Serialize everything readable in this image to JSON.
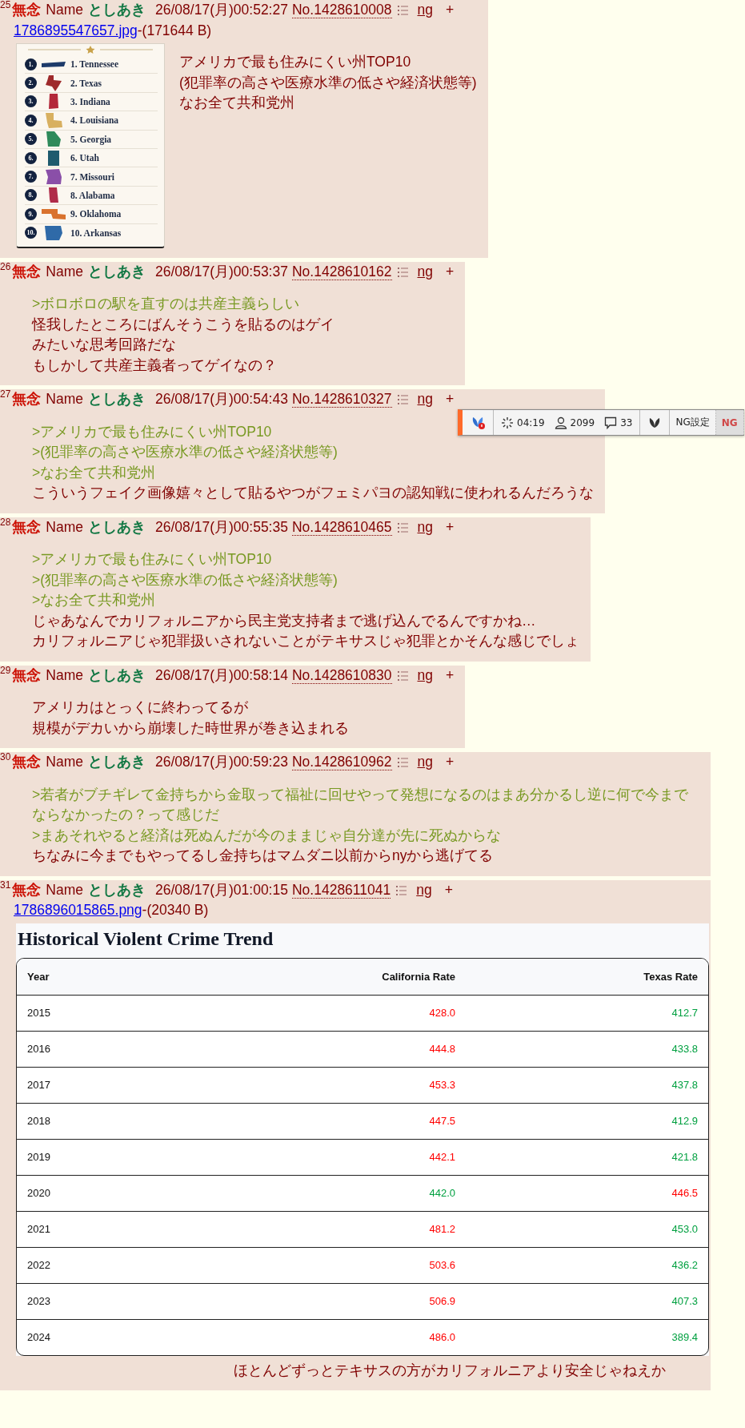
{
  "posts": [
    {
      "number": "25",
      "subject": "無念",
      "name_label": "Name",
      "poster": "としあき",
      "date": "26/08/17(月)00:52:27",
      "no": "No.1428610008",
      "ng": "ng",
      "plus": "+",
      "file": {
        "name": "1786895547657.jpg",
        "size": "-(171644 B)"
      },
      "image": {
        "kind": "ranking",
        "items": [
          {
            "rank": "1.",
            "label": "1. Tennessee",
            "color": "#1d3b6a"
          },
          {
            "rank": "2.",
            "label": "2. Texas",
            "color": "#9e2a2b"
          },
          {
            "rank": "3.",
            "label": "3. Indiana",
            "color": "#b3283a"
          },
          {
            "rank": "4.",
            "label": "4. Louisiana",
            "color": "#d8b060"
          },
          {
            "rank": "5.",
            "label": "5. Georgia",
            "color": "#2e8a5a"
          },
          {
            "rank": "6.",
            "label": "6. Utah",
            "color": "#1e5a6e"
          },
          {
            "rank": "7.",
            "label": "7. Missouri",
            "color": "#8a4fa8"
          },
          {
            "rank": "8.",
            "label": "8. Alabama",
            "color": "#b02c4a"
          },
          {
            "rank": "9.",
            "label": "9. Oklahoma",
            "color": "#d9722e"
          },
          {
            "rank": "10.",
            "label": "10. Arkansas",
            "color": "#2f6aa8"
          }
        ]
      },
      "lines": [
        {
          "kind": "text",
          "text": "アメリカで最も住みにくい州TOP10"
        },
        {
          "kind": "text",
          "text": "(犯罪率の高さや医療水準の低さや経済状態等)"
        },
        {
          "kind": "text",
          "text": "なお全て共和党州"
        }
      ]
    },
    {
      "number": "26",
      "subject": "無念",
      "name_label": "Name",
      "poster": "としあき",
      "date": "26/08/17(月)00:53:37",
      "no": "No.1428610162",
      "ng": "ng",
      "plus": "+",
      "lines": [
        {
          "kind": "quote",
          "text": ">ボロボロの駅を直すのは共産主義らしい"
        },
        {
          "kind": "text",
          "text": "怪我したところにばんそうこうを貼るのはゲイ"
        },
        {
          "kind": "text",
          "text": "みたいな思考回路だな"
        },
        {
          "kind": "text",
          "text": "もしかして共産主義者ってゲイなの？"
        }
      ]
    },
    {
      "number": "27",
      "subject": "無念",
      "name_label": "Name",
      "poster": "としあき",
      "date": "26/08/17(月)00:54:43",
      "no": "No.1428610327",
      "ng": "ng",
      "plus": "+",
      "lines": [
        {
          "kind": "quote",
          "text": ">アメリカで最も住みにくい州TOP10"
        },
        {
          "kind": "quote",
          "text": ">(犯罪率の高さや医療水準の低さや経済状態等)"
        },
        {
          "kind": "quote",
          "text": ">なお全て共和党州"
        },
        {
          "kind": "text",
          "text": "こういうフェイク画像嬉々として貼るやつがフェミパヨの認知戦に使われるんだろうな"
        }
      ]
    },
    {
      "number": "28",
      "subject": "無念",
      "name_label": "Name",
      "poster": "としあき",
      "date": "26/08/17(月)00:55:35",
      "no": "No.1428610465",
      "ng": "ng",
      "plus": "+",
      "lines": [
        {
          "kind": "quote",
          "text": ">アメリカで最も住みにくい州TOP10"
        },
        {
          "kind": "quote",
          "text": ">(犯罪率の高さや医療水準の低さや経済状態等)"
        },
        {
          "kind": "quote",
          "text": ">なお全て共和党州"
        },
        {
          "kind": "text",
          "text": "じゃあなんでカリフォルニアから民主党支持者まで逃げ込んでるんですかね…"
        },
        {
          "kind": "text",
          "text": "カリフォルニアじゃ犯罪扱いされないことがテキサスじゃ犯罪とかそんな感じでしょ"
        }
      ]
    },
    {
      "number": "29",
      "subject": "無念",
      "name_label": "Name",
      "poster": "としあき",
      "date": "26/08/17(月)00:58:14",
      "no": "No.1428610830",
      "ng": "ng",
      "plus": "+",
      "lines": [
        {
          "kind": "text",
          "text": "アメリカはとっくに終わってるが"
        },
        {
          "kind": "text",
          "text": "規模がデカいから崩壊した時世界が巻き込まれる"
        }
      ]
    },
    {
      "number": "30",
      "subject": "無念",
      "name_label": "Name",
      "poster": "としあき",
      "date": "26/08/17(月)00:59:23",
      "no": "No.1428610962",
      "ng": "ng",
      "plus": "+",
      "lines": [
        {
          "kind": "quote",
          "text": ">若者がブチギレて金持ちから金取って福祉に回せやって発想になるのはまあ分かるし逆に何で今までならなかったの？って感じだ"
        },
        {
          "kind": "quote",
          "text": ">まあそれやると経済は死ぬんだが今のままじゃ自分達が先に死ぬからな"
        },
        {
          "kind": "text",
          "text": "ちなみに今までもやってるし金持ちはマムダニ以前からnyから逃げてる"
        }
      ]
    },
    {
      "number": "31",
      "subject": "無念",
      "name_label": "Name",
      "poster": "としあき",
      "date": "26/08/17(月)01:00:15",
      "no": "No.1428611041",
      "ng": "ng",
      "plus": "+",
      "file": {
        "name": "1786896015865.png",
        "size": "-(20340 B)"
      },
      "image": {
        "kind": "table",
        "title": "Historical Violent Crime Trend",
        "columns": [
          "Year",
          "California Rate",
          "Texas Rate"
        ],
        "rows": [
          {
            "year": "2015",
            "california": {
              "value": "428.0",
              "color": "#ff0000"
            },
            "texas": {
              "value": "412.7",
              "color": "#00a040"
            }
          },
          {
            "year": "2016",
            "california": {
              "value": "444.8",
              "color": "#ff0000"
            },
            "texas": {
              "value": "433.8",
              "color": "#00a040"
            }
          },
          {
            "year": "2017",
            "california": {
              "value": "453.3",
              "color": "#ff0000"
            },
            "texas": {
              "value": "437.8",
              "color": "#00a040"
            }
          },
          {
            "year": "2018",
            "california": {
              "value": "447.5",
              "color": "#ff0000"
            },
            "texas": {
              "value": "412.9",
              "color": "#00a040"
            }
          },
          {
            "year": "2019",
            "california": {
              "value": "442.1",
              "color": "#ff0000"
            },
            "texas": {
              "value": "421.8",
              "color": "#00a040"
            }
          },
          {
            "year": "2020",
            "california": {
              "value": "442.0",
              "color": "#00a040"
            },
            "texas": {
              "value": "446.5",
              "color": "#ff0000"
            }
          },
          {
            "year": "2021",
            "california": {
              "value": "481.2",
              "color": "#ff0000"
            },
            "texas": {
              "value": "453.0",
              "color": "#00a040"
            }
          },
          {
            "year": "2022",
            "california": {
              "value": "503.6",
              "color": "#ff0000"
            },
            "texas": {
              "value": "436.2",
              "color": "#00a040"
            }
          },
          {
            "year": "2023",
            "california": {
              "value": "506.9",
              "color": "#ff0000"
            },
            "texas": {
              "value": "407.3",
              "color": "#00a040"
            }
          },
          {
            "year": "2024",
            "california": {
              "value": "486.0",
              "color": "#ff0000"
            },
            "texas": {
              "value": "389.4",
              "color": "#00a040"
            }
          }
        ]
      },
      "lines": [
        {
          "kind": "text",
          "text": "ほとんどずっとテキサスの方がカリフォルニアより安全じゃねえか"
        }
      ]
    }
  ],
  "toolbar": {
    "items": [
      {
        "kind": "logo"
      },
      {
        "kind": "timer",
        "text": "04:19"
      },
      {
        "kind": "users",
        "text": "2099"
      },
      {
        "kind": "replies",
        "text": "33"
      },
      {
        "kind": "leaf"
      },
      {
        "kind": "button",
        "text": "NG設定",
        "selected": false
      },
      {
        "kind": "button",
        "text": "NG",
        "selected": true
      }
    ]
  }
}
